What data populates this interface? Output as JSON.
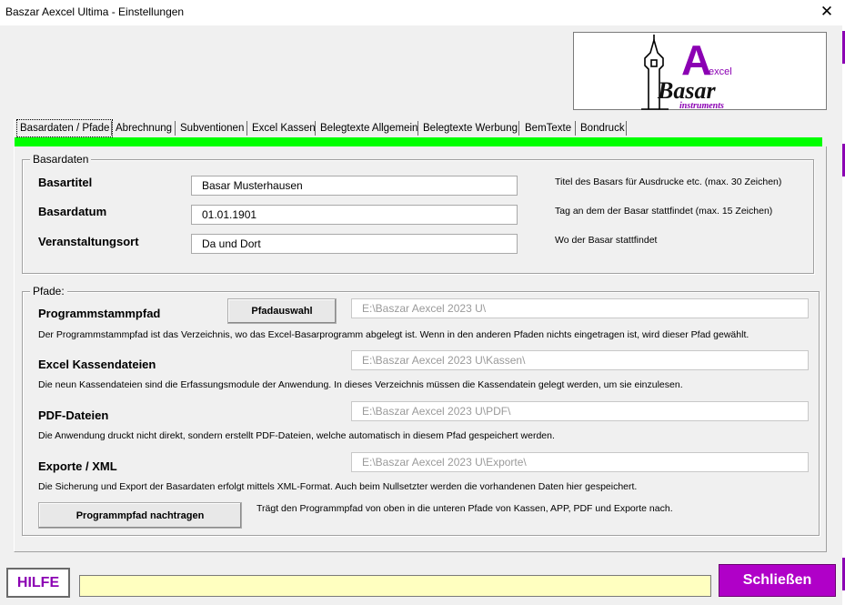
{
  "window": {
    "title": "Baszar Aexcel Ultima - Einstellungen",
    "close_label": "✕"
  },
  "logo": {
    "letter": "A",
    "word": "excel",
    "bazar": "Basar",
    "sub": "instruments"
  },
  "tabs": [
    {
      "label": "Basardaten / Pfade"
    },
    {
      "label": "Abrechnung"
    },
    {
      "label": "Subventionen"
    },
    {
      "label": "Excel Kassen"
    },
    {
      "label": "Belegtexte Allgemein"
    },
    {
      "label": "Belegtexte Werbung"
    },
    {
      "label": "BemTexte"
    },
    {
      "label": "Bondruck"
    }
  ],
  "basardaten": {
    "caption": "Basardaten",
    "rows": [
      {
        "label": "Basartitel",
        "value": "Basar Musterhausen",
        "hint": "Titel des Basars für Ausdrucke etc. (max. 30 Zeichen)"
      },
      {
        "label": "Basardatum",
        "value": "01.01.1901",
        "hint": "Tag an dem der Basar stattfindet (max. 15 Zeichen)"
      },
      {
        "label": "Veranstaltungsort",
        "value": "Da und Dort",
        "hint": "Wo der Basar stattfindet"
      }
    ]
  },
  "pfade": {
    "caption": "Pfade:",
    "pfadauswahl_label": "Pfadauswahl",
    "rows": [
      {
        "label": "Programmstammpfad",
        "value": "E:\\Baszar Aexcel 2023 U\\",
        "desc": "Der Programmstammpfad ist das Verzeichnis, wo das Excel-Basarprogramm abgelegt ist. Wenn in den anderen Pfaden nichts eingetragen ist, wird dieser Pfad gewählt."
      },
      {
        "label": "Excel Kassendateien",
        "value": "E:\\Baszar Aexcel 2023 U\\Kassen\\",
        "desc": "Die neun Kassendateien sind die Erfassungsmodule der Anwendung. In dieses Verzeichnis müssen die Kassendatein gelegt werden, um sie einzulesen."
      },
      {
        "label": "PDF-Dateien",
        "value": "E:\\Baszar Aexcel 2023 U\\PDF\\",
        "desc": "Die Anwendung druckt nicht direkt, sondern erstellt PDF-Dateien, welche automatisch in diesem Pfad gespeichert werden."
      },
      {
        "label": "Exporte / XML",
        "value": "E:\\Baszar Aexcel 2023 U\\Exporte\\",
        "desc": "Die Sicherung und Export der Basardaten erfolgt mittels XML-Format. Auch beim Nullsetzter werden die vorhandenen Daten hier gespeichert."
      }
    ],
    "nachtragen_label": "Programmpfad nachtragen",
    "nachtragen_hint": "Trägt den Programmpfad von oben in die unteren Pfade von Kassen, APP, PDF und Exporte nach."
  },
  "footer": {
    "hilfe_label": "HILFE",
    "status_text": "",
    "schliessen_label": "Schließen"
  },
  "colors": {
    "accent_green": "#00ff00",
    "brand_purple": "#b000c8",
    "status_yellow": "#ffffc0"
  }
}
